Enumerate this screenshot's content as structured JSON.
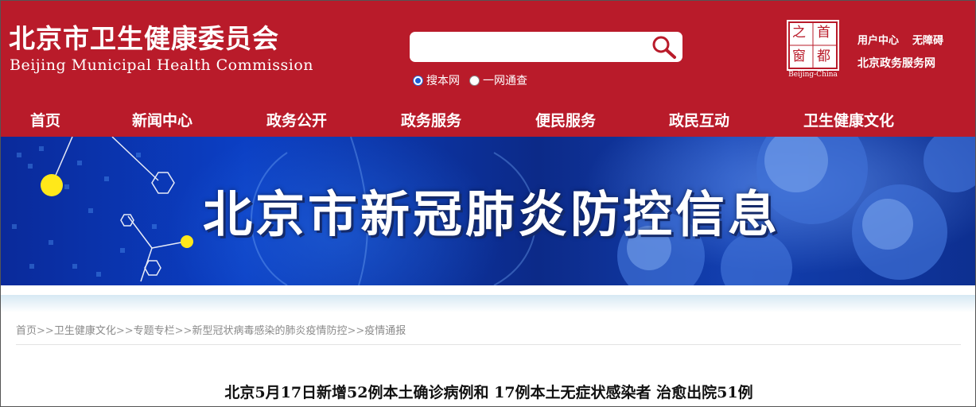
{
  "header": {
    "title": "北京市卫生健康委员会",
    "subtitle": "Beijing Municipal Health Commission",
    "search": {
      "value": "",
      "placeholder": ""
    },
    "radios": [
      {
        "label": "搜本网",
        "checked": true
      },
      {
        "label": "一网通查",
        "checked": false
      }
    ],
    "seal": {
      "chars": [
        "之",
        "首",
        "窗",
        "都"
      ],
      "caption": "Beijing-China"
    },
    "links": {
      "user_center": "用户中心",
      "accessibility": "无障碍",
      "gov_service": "北京政务服务网"
    },
    "nav": [
      "首页",
      "新闻中心",
      "政务公开",
      "政务服务",
      "便民服务",
      "政民互动",
      "卫生健康文化"
    ]
  },
  "banner": {
    "title": "北京市新冠肺炎防控信息"
  },
  "breadcrumb": [
    "首页",
    "卫生健康文化",
    "专题专栏",
    "新型冠状病毒感染的肺炎疫情防控",
    "疫情通报"
  ],
  "breadcrumb_separator": ">>",
  "article": {
    "title": "北京5月17日新增52例本土确诊病例和 17例本土无症状感染者 治愈出院51例"
  },
  "icons": {
    "search": "search-icon"
  },
  "colors": {
    "brand_red": "#b91b2a",
    "banner_blue": "#0b3fc4",
    "crumb_gray": "#8a8a8a"
  }
}
